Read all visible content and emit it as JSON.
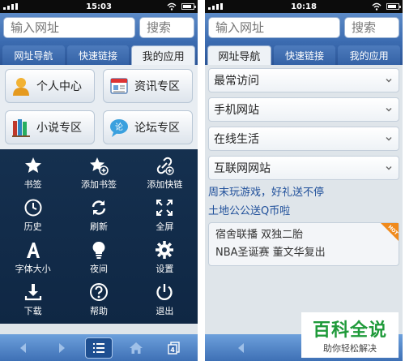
{
  "left": {
    "status_time": "15:03",
    "url_placeholder": "输入网址",
    "search_placeholder": "搜索",
    "tabs": [
      "网址导航",
      "快速链接",
      "我的应用"
    ],
    "apps": [
      {
        "label": "个人中心",
        "icon": "user-icon"
      },
      {
        "label": "资讯专区",
        "icon": "news-icon"
      },
      {
        "label": "小说专区",
        "icon": "books-icon"
      },
      {
        "label": "论坛专区",
        "icon": "forum-icon"
      }
    ],
    "menu": [
      {
        "label": "书签",
        "icon": "star-icon"
      },
      {
        "label": "添加书签",
        "icon": "star-add-icon"
      },
      {
        "label": "添加快链",
        "icon": "link-add-icon"
      },
      {
        "label": "历史",
        "icon": "clock-icon"
      },
      {
        "label": "刷新",
        "icon": "refresh-icon"
      },
      {
        "label": "全屏",
        "icon": "fullscreen-icon"
      },
      {
        "label": "字体大小",
        "icon": "font-size-icon"
      },
      {
        "label": "夜间",
        "icon": "bulb-icon"
      },
      {
        "label": "设置",
        "icon": "gear-icon"
      },
      {
        "label": "下载",
        "icon": "download-icon"
      },
      {
        "label": "帮助",
        "icon": "help-icon"
      },
      {
        "label": "退出",
        "icon": "power-icon"
      }
    ]
  },
  "right": {
    "status_time": "10:18",
    "url_placeholder": "输入网址",
    "search_placeholder": "搜索",
    "tabs": [
      "网址导航",
      "快速链接",
      "我的应用"
    ],
    "sections": [
      "最常访问",
      "手机网站",
      "在线生活",
      "互联网网站"
    ],
    "promos": [
      "周末玩游戏，好礼送不停",
      "土地公公送Q币啦"
    ],
    "news": [
      "宿舍联播 双独二胎",
      "NBA圣诞赛 董文华复出"
    ],
    "badge": "HOT"
  },
  "watermark": {
    "title": "百科全说",
    "subtitle": "助你轻松解决"
  },
  "colors": {
    "accent_blue": "#3b6bb0",
    "menu_bg": "#15304f",
    "link_blue": "#1f4f9a",
    "watermark_green": "#1f9a3a"
  }
}
